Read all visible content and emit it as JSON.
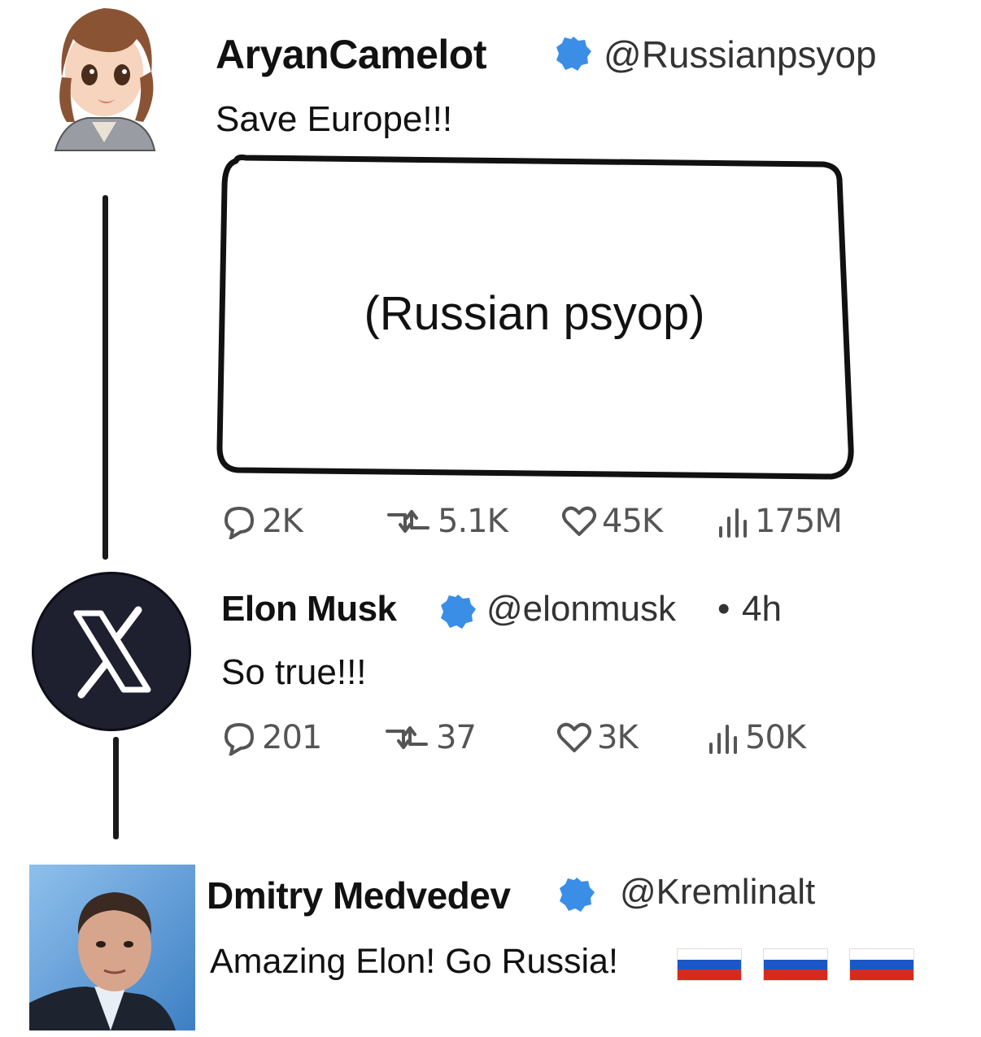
{
  "tweets": [
    {
      "name": "AryanCamelot",
      "handle": "@Russianpsyop",
      "text": "Save Europe!!!",
      "media_label": "(Russian psyop)",
      "stats": {
        "replies": "2K",
        "reposts": "5.1K",
        "likes": "45K",
        "views": "175M"
      },
      "avatar_icon": "anime-girl-avatar"
    },
    {
      "name": "Elon Musk",
      "handle": "@elonmusk",
      "time": "4h",
      "text": "So true!!!",
      "stats": {
        "replies": "201",
        "reposts": "37",
        "likes": "3K",
        "views": "50K"
      },
      "avatar_icon": "x-logo-avatar"
    },
    {
      "name": "Dmitry Medvedev",
      "handle": "@Kremlinalt",
      "text": "Amazing Elon! Go Russia!",
      "flags": [
        "russian-flag",
        "russian-flag",
        "russian-flag"
      ],
      "avatar_icon": "portrait-photo-avatar"
    }
  ],
  "colors": {
    "verified_badge": "#3a8ee6",
    "stats_gray": "#555555",
    "flag_white": "#ffffff",
    "flag_blue": "#1c57c7",
    "flag_red": "#d52b1e",
    "x_avatar_bg": "#1e2030"
  }
}
